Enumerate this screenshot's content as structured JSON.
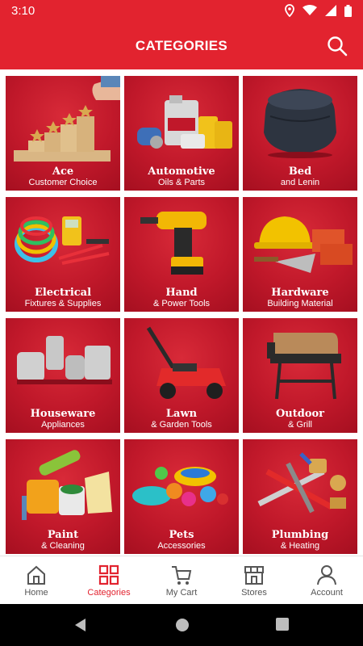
{
  "status": {
    "time": "3:10"
  },
  "header": {
    "title": "CATEGORIES"
  },
  "categories": [
    {
      "title": "Ace",
      "subtitle": "Customer Choice"
    },
    {
      "title": "Automotive",
      "subtitle": "Oils & Parts"
    },
    {
      "title": "Bed",
      "subtitle": "and Lenin"
    },
    {
      "title": "Electrical",
      "subtitle": "Fixtures & Supplies"
    },
    {
      "title": "Hand",
      "subtitle": "& Power Tools"
    },
    {
      "title": "Hardware",
      "subtitle": "Building Material"
    },
    {
      "title": "Houseware",
      "subtitle": "Appliances"
    },
    {
      "title": "Lawn",
      "subtitle": "& Garden Tools"
    },
    {
      "title": "Outdoor",
      "subtitle": "& Grill"
    },
    {
      "title": "Paint",
      "subtitle": "& Cleaning"
    },
    {
      "title": "Pets",
      "subtitle": "Accessories"
    },
    {
      "title": "Plumbing",
      "subtitle": "& Heating"
    }
  ],
  "nav": {
    "items": [
      {
        "label": "Home",
        "icon": "home-icon"
      },
      {
        "label": "Categories",
        "icon": "grid-icon",
        "active": true
      },
      {
        "label": "My Cart",
        "icon": "cart-icon"
      },
      {
        "label": "Stores",
        "icon": "store-icon"
      },
      {
        "label": "Account",
        "icon": "account-icon"
      }
    ]
  },
  "colors": {
    "brand": "#e2232f",
    "tile": "#c0182a",
    "active": "#e2232f",
    "inactive": "#555555"
  }
}
